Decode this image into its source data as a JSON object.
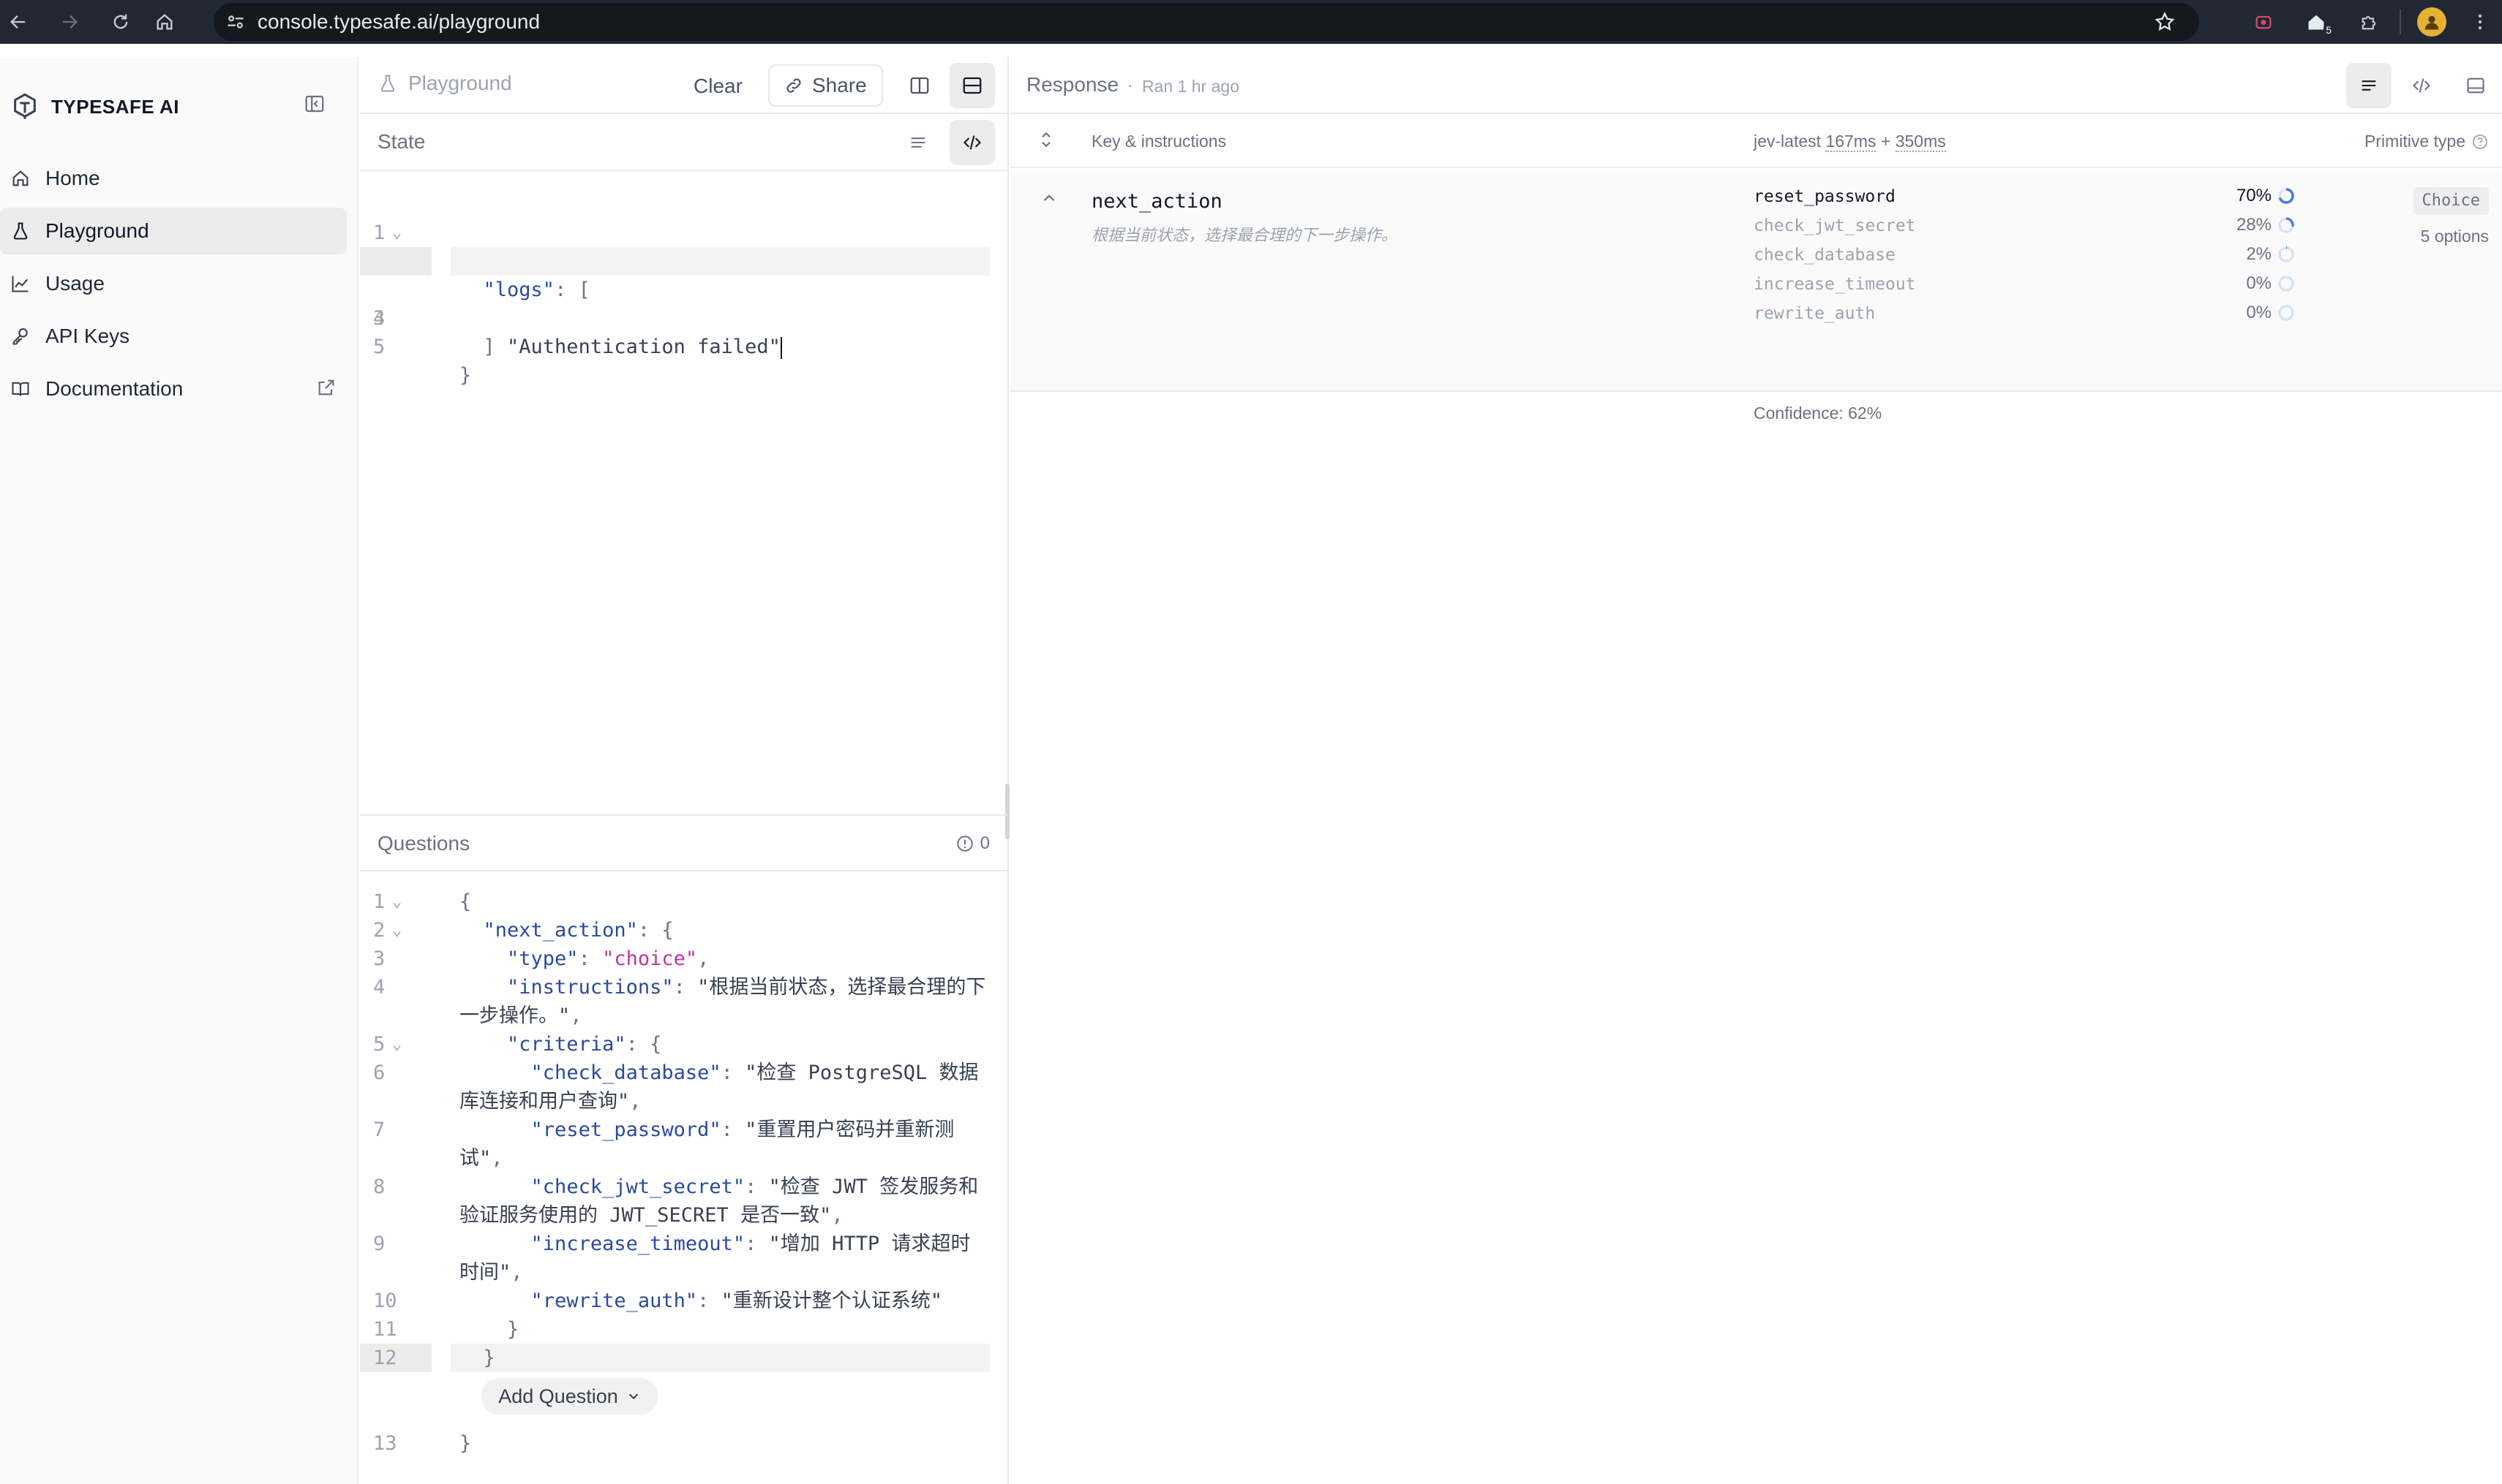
{
  "browser": {
    "url": "console.typesafe.ai/playground",
    "extension_badge": "5"
  },
  "sidebar": {
    "brand": "TYPESAFE AI",
    "items": [
      {
        "label": "Home",
        "icon": "home-icon",
        "active": false
      },
      {
        "label": "Playground",
        "icon": "flask-icon",
        "active": true
      },
      {
        "label": "Usage",
        "icon": "chart-line-icon",
        "active": false
      },
      {
        "label": "API Keys",
        "icon": "key-icon",
        "active": false
      },
      {
        "label": "Documentation",
        "icon": "book-icon",
        "active": false,
        "external": true
      }
    ]
  },
  "playground": {
    "title": "Playground",
    "clear_label": "Clear",
    "share_label": "Share"
  },
  "state": {
    "label": "State",
    "lines": [
      {
        "n": "1",
        "fold": true
      },
      {
        "n": "2",
        "fold": true
      },
      {
        "n": "3",
        "fold": false
      },
      {
        "n": "4",
        "fold": false
      },
      {
        "n": "5",
        "fold": false
      }
    ],
    "logs_key": "\"logs\"",
    "log_value": "\"Authentication failed\""
  },
  "questions": {
    "label": "Questions",
    "issue_count": "0",
    "code": {
      "next_action_key": "\"next_action\"",
      "type_key": "\"type\"",
      "type_value": "\"choice\"",
      "instructions_key": "\"instructions\"",
      "instructions_value": "\"根据当前状态，选择最合理的下一步操作。\"",
      "criteria_key": "\"criteria\"",
      "criteria": [
        {
          "key": "\"check_database\"",
          "value": "\"检查 PostgreSQL 数据库连接和用户查询\""
        },
        {
          "key": "\"reset_password\"",
          "value": "\"重置用户密码并重新测试\""
        },
        {
          "key": "\"check_jwt_secret\"",
          "value": "\"检查 JWT 签发服务和验证服务使用的 JWT_SECRET 是否一致\""
        },
        {
          "key": "\"increase_timeout\"",
          "value": "\"增加 HTTP 请求超时时间\""
        },
        {
          "key": "\"rewrite_auth\"",
          "value": "\"重新设计整个认证系统\""
        }
      ]
    },
    "line_numbers": [
      "1",
      "2",
      "3",
      "4",
      "5",
      "6",
      "7",
      "8",
      "9",
      "10",
      "11",
      "12",
      "13"
    ],
    "add_question_label": "Add Question"
  },
  "response": {
    "title": "Response",
    "ran": "Ran 1 hr ago",
    "header": {
      "key_col": "Key & instructions",
      "model": "jev-latest",
      "latency_a": "167ms",
      "plus": "+",
      "latency_b": "350ms",
      "type_col": "Primitive type"
    },
    "row": {
      "key": "next_action",
      "instructions": "根据当前状态，选择最合理的下一步操作。",
      "options": [
        {
          "name": "reset_password",
          "pct": "70%",
          "value": 0.7
        },
        {
          "name": "check_jwt_secret",
          "pct": "28%",
          "value": 0.28
        },
        {
          "name": "check_database",
          "pct": "2%",
          "value": 0.02
        },
        {
          "name": "increase_timeout",
          "pct": "0%",
          "value": 0.0
        },
        {
          "name": "rewrite_auth",
          "pct": "0%",
          "value": 0.0
        }
      ],
      "confidence": "Confidence: 62%",
      "type_badge": "Choice",
      "options_count": "5 options"
    }
  },
  "colors": {
    "accent": "#4f7bd6",
    "chrome_bg": "#222734",
    "sidebar_bg": "#fafafa"
  }
}
